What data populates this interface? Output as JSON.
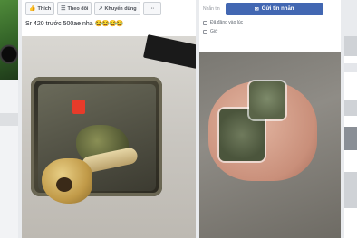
{
  "mid": {
    "toolbar": {
      "like_label": "Thích",
      "follow_label": "Theo dõi",
      "recommend_label": "Khuyến dùng",
      "more_label": "···"
    },
    "caption_text": "Sr 420 trước 500ae nha",
    "caption_emoji": "😂😂😂😂"
  },
  "right": {
    "send_prefix": "Nhắn tin",
    "send_button_label": "Gửi tin nhắn",
    "info_lines": [
      "Đã đăng vào lúc",
      "Giờ"
    ]
  }
}
